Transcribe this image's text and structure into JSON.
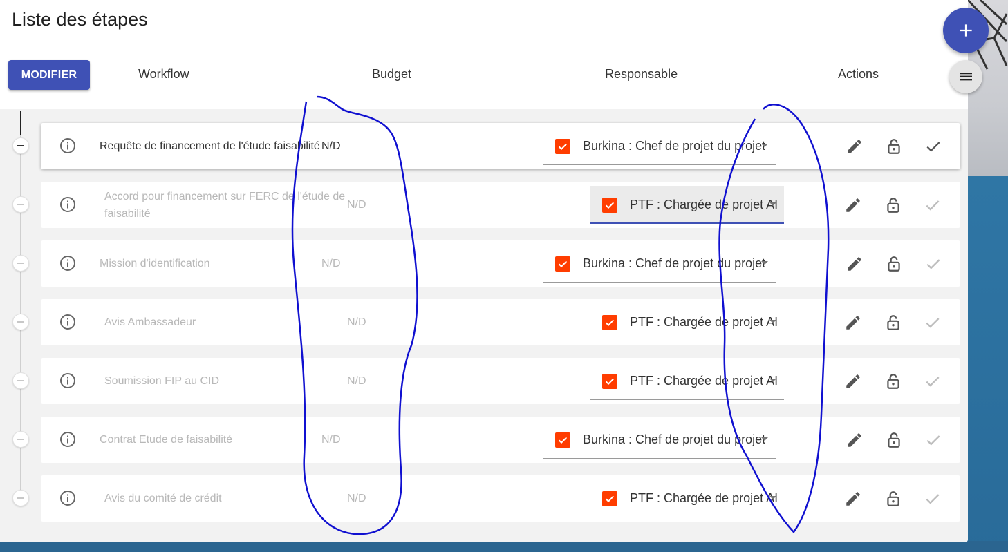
{
  "page": {
    "title": "Liste des étapes",
    "modify_label": "MODIFIER"
  },
  "columns": {
    "workflow": "Workflow",
    "budget": "Budget",
    "responsable": "Responsable",
    "actions": "Actions"
  },
  "colors": {
    "primary": "#3f51b5",
    "checkbox": "#ff3d00",
    "annotation": "#0000cc"
  },
  "icons": {
    "fab": "add-icon",
    "menu": "menu-icon",
    "info": "info-icon",
    "edit": "edit-icon",
    "lock": "lock-open-icon",
    "validate": "check-icon"
  },
  "steps": [
    {
      "name": "Requête de financement de l'étude faisabilité",
      "budget": "N/D",
      "responsable": "Burkina : Chef de projet du projet",
      "active": true
    },
    {
      "name": "Accord pour financement sur FERC de l'étude de faisabilité",
      "budget": "N/D",
      "responsable": "PTF : Chargée de projet AI",
      "active": false
    },
    {
      "name": "Mission d'identification",
      "budget": "N/D",
      "responsable": "Burkina : Chef de projet du projet",
      "active": false
    },
    {
      "name": "Avis Ambassadeur",
      "budget": "N/D",
      "responsable": "PTF : Chargée de projet AI",
      "active": false
    },
    {
      "name": "Soumission FIP au CID",
      "budget": "N/D",
      "responsable": "PTF : Chargée de projet AI",
      "active": false
    },
    {
      "name": "Contrat Etude de faisabilité",
      "budget": "N/D",
      "responsable": "Burkina : Chef de projet du projet",
      "active": false
    },
    {
      "name": "Avis du comité de crédit",
      "budget": "N/D",
      "responsable": "PTF : Chargée de projet AI",
      "active": false
    }
  ]
}
